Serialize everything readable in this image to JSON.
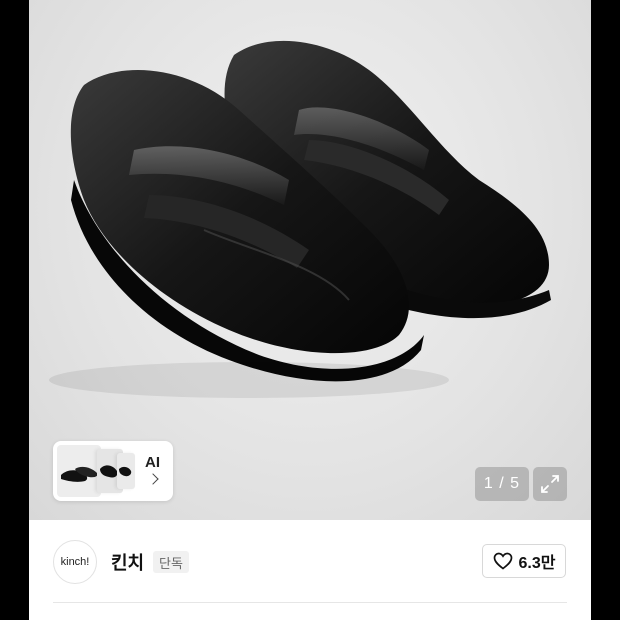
{
  "gallery": {
    "ai_label": "AI",
    "counter": "1 / 5",
    "image_alt": "black leather penny loafers"
  },
  "seller": {
    "logo_text": "kinch!",
    "name": "킨치",
    "badge": "단독"
  },
  "likes": {
    "count": "6.3만",
    "icon": "heart-icon"
  },
  "colors": {
    "text_primary": "#111111",
    "badge_bg": "#f1f1f1",
    "overlay": "#969696"
  }
}
